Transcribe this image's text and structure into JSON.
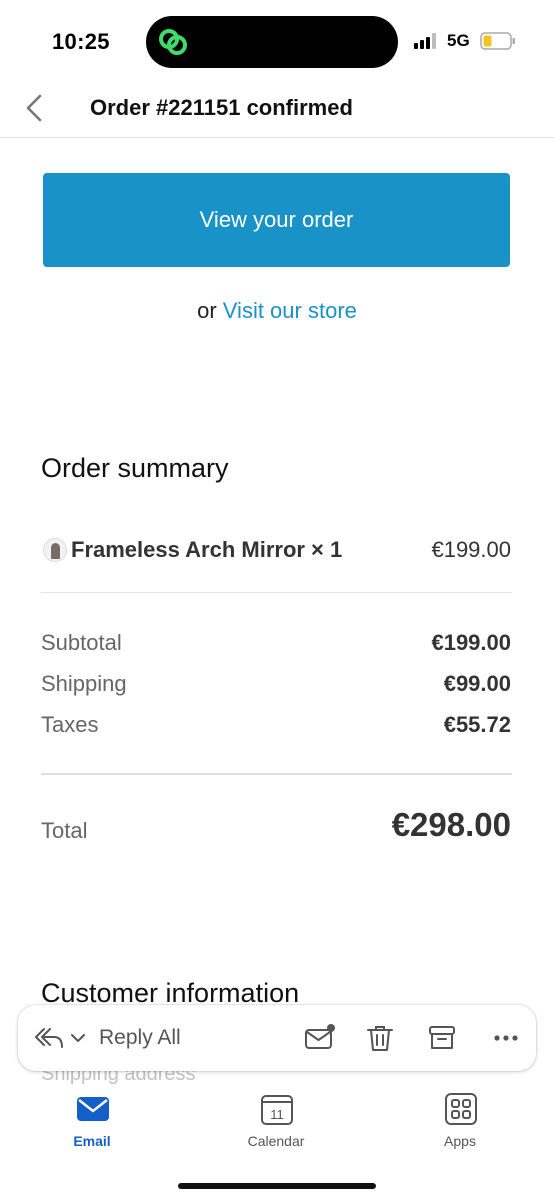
{
  "status_bar": {
    "time": "10:25",
    "network": "5G",
    "icons": [
      "signal-bars-icon",
      "battery-low-icon",
      "app-link-icon"
    ]
  },
  "nav": {
    "title": "Order #221151 confirmed",
    "back_icon": "chevron-left-icon"
  },
  "order": {
    "view_button_label": "View your order",
    "or_text": "or",
    "visit_store_label": "Visit our store"
  },
  "summary": {
    "title": "Order summary",
    "line_items": [
      {
        "name": "Frameless Arch Mirror × 1",
        "price": "€199.00"
      }
    ],
    "rows": [
      {
        "label": "Subtotal",
        "value": "€199.00"
      },
      {
        "label": "Shipping",
        "value": "€99.00"
      },
      {
        "label": "Taxes",
        "value": "€55.72"
      }
    ],
    "total_label": "Total",
    "total_value": "€298.00"
  },
  "customer": {
    "title": "Customer information",
    "shipping_address_label": "Shipping address"
  },
  "toolbar": {
    "reply_label": "Reply All",
    "icons": [
      "reply-all-icon",
      "chevron-down-icon",
      "mark-unread-icon",
      "trash-icon",
      "archive-icon",
      "more-icon"
    ]
  },
  "tabs": [
    {
      "label": "Email",
      "icon": "mail-icon",
      "active": true
    },
    {
      "label": "Calendar",
      "icon": "calendar-icon",
      "day": "11",
      "active": false
    },
    {
      "label": "Apps",
      "icon": "apps-grid-icon",
      "active": false
    }
  ],
  "colors": {
    "accent": "#1992c8",
    "tab_active": "#1360c8",
    "text_primary": "#111111",
    "text_muted": "#666666",
    "battery_low": "#f2c522",
    "island_icon": "#3ddc6b"
  }
}
